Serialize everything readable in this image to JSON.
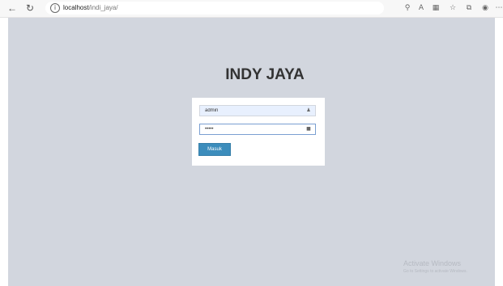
{
  "browser": {
    "back_icon": "arrow-left-icon",
    "refresh_icon": "refresh-icon",
    "url_host": "localhost",
    "url_path": "/indi_jaya/",
    "toolbar_icons": [
      "read-aloud-icon",
      "translate-icon",
      "extensions-icon",
      "favorites-icon",
      "collections-icon",
      "profile-icon",
      "more-icon"
    ]
  },
  "page": {
    "title": "INDY JAYA",
    "background": "#d2d6de"
  },
  "login": {
    "username_value": "admin",
    "password_value": "•••••",
    "username_icon": "user-icon",
    "password_icon": "lock-icon",
    "submit_label": "Masuk",
    "accent": "#3c8dbc"
  },
  "watermark": {
    "title": "Activate Windows",
    "subtitle": "Go to Settings to activate Windows."
  }
}
